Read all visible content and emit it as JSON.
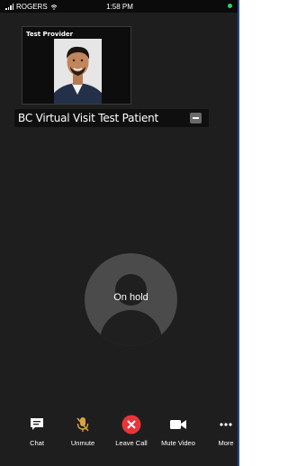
{
  "status_bar": {
    "carrier": "ROGERS",
    "time": "1:58 PM"
  },
  "provider": {
    "label": "Test Provider"
  },
  "patient": {
    "name": "BC Virtual Visit Test Patient"
  },
  "call": {
    "status": "On hold"
  },
  "controls": [
    {
      "label": "Chat",
      "icon": "chat-icon"
    },
    {
      "label": "Unmute",
      "icon": "mic-muted-icon"
    },
    {
      "label": "Leave Call",
      "icon": "leave-call-icon"
    },
    {
      "label": "Mute Video",
      "icon": "video-camera-icon"
    },
    {
      "label": "More",
      "icon": "more-icon"
    }
  ],
  "colors": {
    "accent_red": "#e8353a",
    "muted_mic": "#d9a441",
    "online": "#2fd158"
  }
}
